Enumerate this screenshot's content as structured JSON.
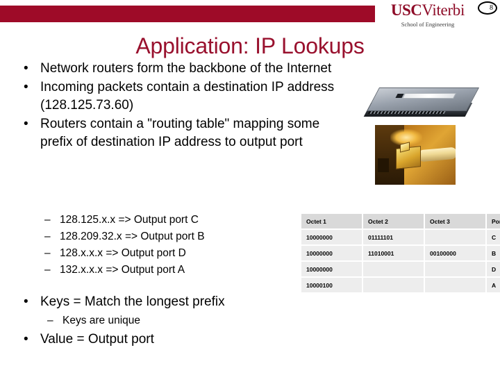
{
  "header": {
    "logo_usc": "USC",
    "logo_viterbi": "Viterbi",
    "logo_subtitle": "School of Engineering",
    "page_number": "8",
    "bar_color": "#9e0b28"
  },
  "title": "Application: IP Lookups",
  "title_color": "#99112e",
  "bullets": [
    {
      "bullet": "•",
      "text": "Network routers form the backbone of the Internet"
    },
    {
      "bullet": "•",
      "text": "Incoming packets contain a destination IP address (128.125.73.60)"
    },
    {
      "bullet": "•",
      "text": "Routers contain a \"routing table\" mapping some prefix of destination IP address to output port"
    }
  ],
  "mappings": [
    {
      "dash": "–",
      "text": "128.125.x.x => Output port C"
    },
    {
      "dash": "–",
      "text": "128.209.32.x => Output port B"
    },
    {
      "dash": "–",
      "text": "128.x.x.x => Output port D"
    },
    {
      "dash": "–",
      "text": "132.x.x.x => Output port A"
    }
  ],
  "tail": {
    "keys_bullet": "•",
    "keys_text": "Keys = Match the longest prefix",
    "keys_sub_dash": "–",
    "keys_sub_text": "Keys are unique",
    "value_bullet": "•",
    "value_text": "Value = Output port"
  },
  "images": [
    {
      "name": "network-switch-photo",
      "alt": "rack mount network switch"
    },
    {
      "name": "ethernet-cable-photo",
      "alt": "ethernet cable plugged into port"
    }
  ],
  "table": {
    "headers": [
      "Octet 1",
      "Octet 2",
      "Octet 3",
      "Port"
    ],
    "rows": [
      {
        "octet1": "10000000",
        "octet2": "01111101",
        "octet3": "",
        "port": "C"
      },
      {
        "octet1": "10000000",
        "octet2": "11010001",
        "octet3": "00100000",
        "port": "B"
      },
      {
        "octet1": "10000000",
        "octet2": "",
        "octet3": "",
        "port": "D"
      },
      {
        "octet1": "10000100",
        "octet2": "",
        "octet3": "",
        "port": "A"
      }
    ],
    "header_bg": "#d9d9d9",
    "cell_bg": "#ededed"
  }
}
